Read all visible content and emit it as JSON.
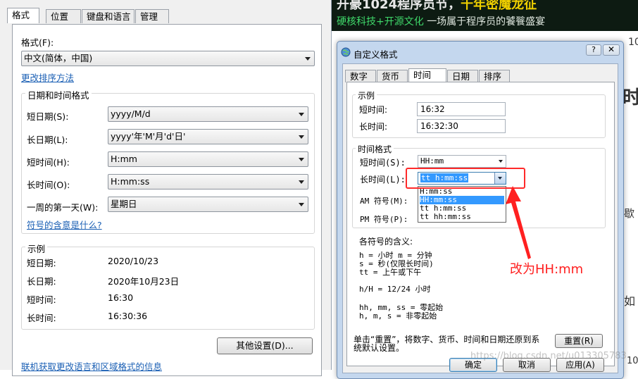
{
  "background_page": {
    "banner_line1_a": "开豪1024程序员节，",
    "banner_line1_b": "千年密魔龙征",
    "banner_line2_a": "硬核科技+开源文化",
    "banner_line2_b": "一场属于程序员的饕餮盛宴",
    "side_snippets": [
      "10",
      "时",
      "歇",
      "如",
      "10"
    ]
  },
  "region_window": {
    "tabs": [
      "格式",
      "位置",
      "键盘和语言",
      "管理"
    ],
    "format_label": "格式(F):",
    "format_value": "中文(简体，中国)",
    "change_sort_link": "更改排序方法",
    "datetime_group_title": "日期和时间格式",
    "rows": [
      {
        "label": "短日期(S):",
        "value": "yyyy/M/d"
      },
      {
        "label": "长日期(L):",
        "value": "yyyy'年'M'月'd'日'"
      },
      {
        "label": "短时间(H):",
        "value": "H:mm"
      },
      {
        "label": "长时间(O):",
        "value": "H:mm:ss"
      },
      {
        "label": "一周的第一天(W):",
        "value": "星期日"
      }
    ],
    "symbol_meaning_link": "符号的含意是什么?",
    "example_group_title": "示例",
    "examples": [
      {
        "label": "短日期:",
        "value": "2020/10/23"
      },
      {
        "label": "长日期:",
        "value": "2020年10月23日"
      },
      {
        "label": "短时间:",
        "value": "16:30"
      },
      {
        "label": "长时间:",
        "value": "16:30:36"
      }
    ],
    "other_settings_button": "其他设置(D)...",
    "online_link": "联机获取更改语言和区域格式的信息"
  },
  "custom_dialog": {
    "title": "自定义格式",
    "help_button": "?",
    "close_button": "✕",
    "tabs": [
      "数字",
      "货币",
      "时间",
      "日期",
      "排序"
    ],
    "example_group_title": "示例",
    "short_time_label": "短时间:",
    "short_time_value": "16:32",
    "long_time_label": "长时间:",
    "long_time_value": "16:32:30",
    "time_format_group_title": "时间格式",
    "short_time_combo_label": "短时间(S):",
    "short_time_combo_value": "HH:mm",
    "long_time_combo_label": "长时间(L):",
    "long_time_combo_value": "tt h:mm:ss",
    "dropdown_options": [
      "H:mm:ss",
      "HH:mm:ss",
      "tt h:mm:ss",
      "tt hh:mm:ss"
    ],
    "dropdown_selected_index": 1,
    "am_label": "AM 符号(M):",
    "pm_label": "PM 符号(P):",
    "legend_title": "各符号的含义:",
    "legend_lines": [
      "h = 小时   m = 分钟",
      "s = 秒(仅限长时间)",
      "tt = 上午或下午",
      "",
      "h/H = 12/24 小时",
      "",
      "hh, mm, ss = 零起始",
      "h, m, s = 非零起始"
    ],
    "reset_note_line1": "单击“重置”，将数字、货币、时间和日期还原到系",
    "reset_note_line2": "统默认设置。",
    "reset_button": "重置(R)",
    "ok_button": "确定",
    "cancel_button": "取消",
    "apply_button": "应用(A)"
  },
  "annotation_text": "改为HH:mm",
  "watermark": "https://blog.csdn.net/u013305783",
  "colors": {
    "annotation_red": "#ff2020",
    "link_blue": "#1a5fb4",
    "selection_blue": "#3399ff",
    "dialog_frame": "#c4d7ee"
  }
}
